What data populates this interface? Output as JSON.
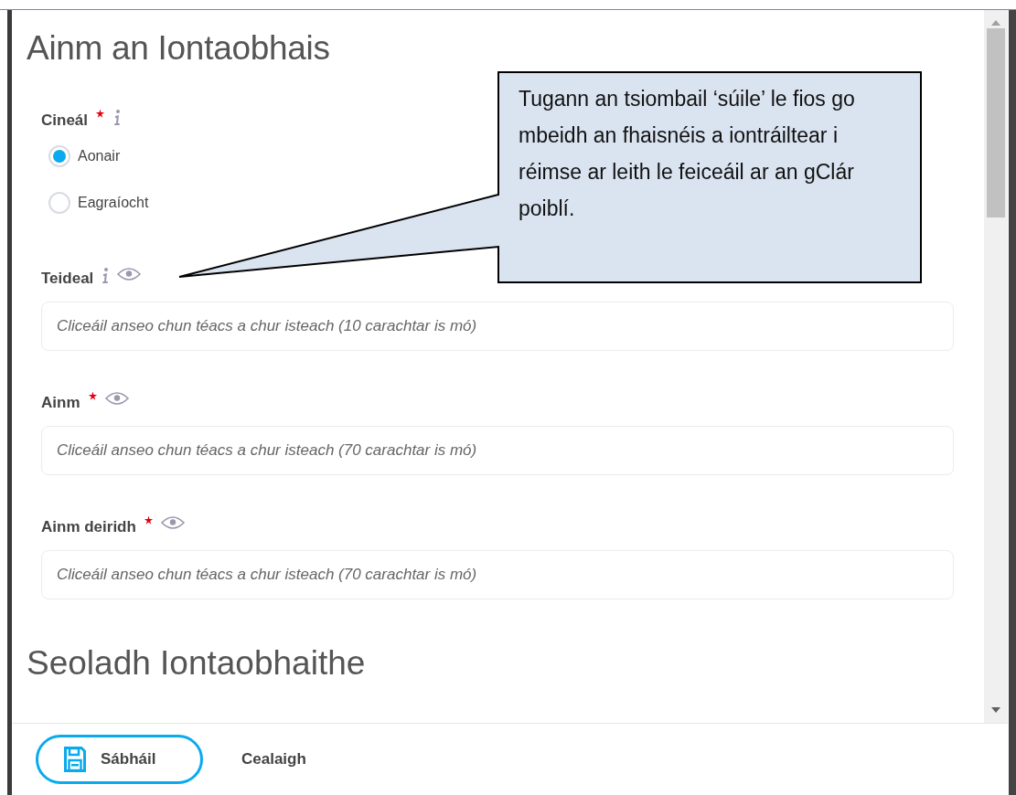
{
  "form": {
    "heading": "Ainm an Iontaobhais",
    "fields": [
      {
        "kind": "radio",
        "label": "Cineál",
        "required": true,
        "info": true,
        "public": false,
        "options": [
          {
            "label": "Aonair",
            "selected": true
          },
          {
            "label": "Eagraíocht",
            "selected": false
          }
        ]
      },
      {
        "kind": "text",
        "label": "Teideal",
        "required": false,
        "info": true,
        "public": true,
        "placeholder": "Cliceáil anseo chun téacs a chur isteach (10 carachtar is mó)"
      },
      {
        "kind": "text",
        "label": "Ainm",
        "required": true,
        "info": false,
        "public": true,
        "placeholder": "Cliceáil anseo chun téacs a chur isteach (70 carachtar is mó)"
      },
      {
        "kind": "text",
        "label": "Ainm deiridh",
        "required": true,
        "info": false,
        "public": true,
        "placeholder": "Cliceáil anseo chun téacs a chur isteach (70 carachtar is mó)"
      }
    ],
    "next_heading": "Seoladh Iontaobhaithe"
  },
  "callout": {
    "text": "Tugann an tsiombail ‘súile’ le fios go mbeidh an fhaisnéis a iontráiltear i réimse ar leith le feiceáil ar an gClár poiblí."
  },
  "footer": {
    "buttons": [
      {
        "label": "Sábháil",
        "kind": "primary"
      },
      {
        "label": "Cealaigh",
        "kind": "plain"
      }
    ]
  }
}
